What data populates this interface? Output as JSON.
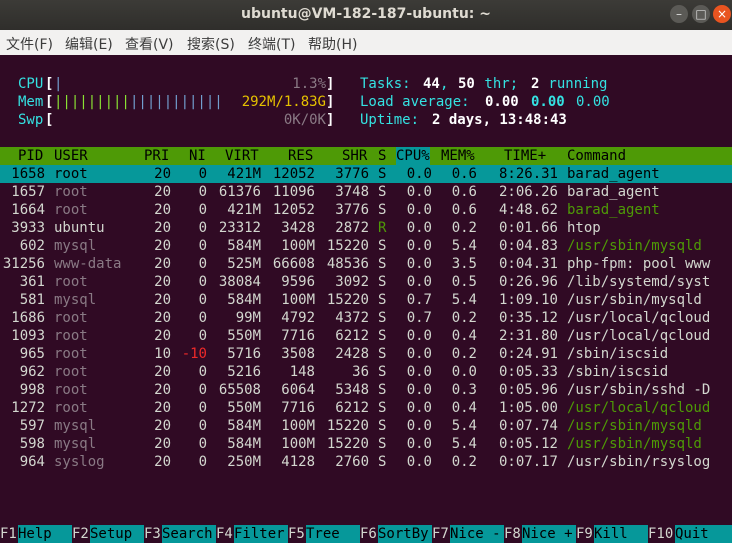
{
  "window": {
    "title": "ubuntu@VM-182-187-ubuntu: ~"
  },
  "menu": [
    "文件(F)",
    "编辑(E)",
    "查看(V)",
    "搜索(S)",
    "终端(T)",
    "帮助(H)"
  ],
  "meters": {
    "cpu": {
      "label": "CPU",
      "bar": "|",
      "value": "1.3%"
    },
    "mem": {
      "label": "Mem",
      "bar_blue": "|||||||||",
      "bar_yellow": "|||||||||||",
      "value": "292M/1.83G"
    },
    "swp": {
      "label": "Swp",
      "bar": "",
      "value": "0K/0K"
    }
  },
  "summary": {
    "tasks_label": "Tasks: ",
    "tasks": "44",
    "sep": ", ",
    "thr": "50",
    "thr_label": " thr; ",
    "running": "2",
    "running_label": " running",
    "load_label": "Load average: ",
    "load1": "0.00",
    "load5": "0.00",
    "load15": "0.00",
    "uptime_label": "Uptime: ",
    "uptime": "2 days, 13:48:43"
  },
  "columns": [
    "PID",
    "USER",
    "PRI",
    "NI",
    "VIRT",
    "RES",
    "SHR",
    "S",
    "CPU%",
    "MEM%",
    "TIME+",
    "Command"
  ],
  "processes": [
    {
      "pid": "1658",
      "user": "root",
      "pri": "20",
      "ni": "0",
      "virt": "421M",
      "res": "12052",
      "shr": "3776",
      "s": "S",
      "cpu": "0.0",
      "mem": "0.6",
      "time": "8:26.31",
      "cmd": "barad_agent"
    },
    {
      "pid": "1657",
      "user": "root",
      "pri": "20",
      "ni": "0",
      "virt": "61376",
      "res": "11096",
      "shr": "3748",
      "s": "S",
      "cpu": "0.0",
      "mem": "0.6",
      "time": "2:06.26",
      "cmd": "barad_agent"
    },
    {
      "pid": "1664",
      "user": "root",
      "pri": "20",
      "ni": "0",
      "virt": "421M",
      "res": "12052",
      "shr": "3776",
      "s": "S",
      "cpu": "0.0",
      "mem": "0.6",
      "time": "4:48.62",
      "cmd": "barad_agent"
    },
    {
      "pid": "3933",
      "user": "ubuntu",
      "pri": "20",
      "ni": "0",
      "virt": "23312",
      "res": "3428",
      "shr": "2872",
      "s": "R",
      "cpu": "0.0",
      "mem": "0.2",
      "time": "0:01.66",
      "cmd": "htop"
    },
    {
      "pid": "602",
      "user": "mysql",
      "pri": "20",
      "ni": "0",
      "virt": "584M",
      "res": "100M",
      "shr": "15220",
      "s": "S",
      "cpu": "0.0",
      "mem": "5.4",
      "time": "0:04.83",
      "cmd": "/usr/sbin/mysqld"
    },
    {
      "pid": "31256",
      "user": "www-data",
      "pri": "20",
      "ni": "0",
      "virt": "525M",
      "res": "66608",
      "shr": "48536",
      "s": "S",
      "cpu": "0.0",
      "mem": "3.5",
      "time": "0:04.31",
      "cmd": "php-fpm: pool www"
    },
    {
      "pid": "361",
      "user": "root",
      "pri": "20",
      "ni": "0",
      "virt": "38084",
      "res": "9596",
      "shr": "3092",
      "s": "S",
      "cpu": "0.0",
      "mem": "0.5",
      "time": "0:26.96",
      "cmd": "/lib/systemd/syst"
    },
    {
      "pid": "581",
      "user": "mysql",
      "pri": "20",
      "ni": "0",
      "virt": "584M",
      "res": "100M",
      "shr": "15220",
      "s": "S",
      "cpu": "0.7",
      "mem": "5.4",
      "time": "1:09.10",
      "cmd": "/usr/sbin/mysqld"
    },
    {
      "pid": "1686",
      "user": "root",
      "pri": "20",
      "ni": "0",
      "virt": "99M",
      "res": "4792",
      "shr": "4372",
      "s": "S",
      "cpu": "0.7",
      "mem": "0.2",
      "time": "0:35.12",
      "cmd": "/usr/local/qcloud"
    },
    {
      "pid": "1093",
      "user": "root",
      "pri": "20",
      "ni": "0",
      "virt": "550M",
      "res": "7716",
      "shr": "6212",
      "s": "S",
      "cpu": "0.0",
      "mem": "0.4",
      "time": "2:31.80",
      "cmd": "/usr/local/qcloud"
    },
    {
      "pid": "965",
      "user": "root",
      "pri": "10",
      "ni": "-10",
      "virt": "5716",
      "res": "3508",
      "shr": "2428",
      "s": "S",
      "cpu": "0.0",
      "mem": "0.2",
      "time": "0:24.91",
      "cmd": "/sbin/iscsid"
    },
    {
      "pid": "962",
      "user": "root",
      "pri": "20",
      "ni": "0",
      "virt": "5216",
      "res": "148",
      "shr": "36",
      "s": "S",
      "cpu": "0.0",
      "mem": "0.0",
      "time": "0:05.33",
      "cmd": "/sbin/iscsid"
    },
    {
      "pid": "998",
      "user": "root",
      "pri": "20",
      "ni": "0",
      "virt": "65508",
      "res": "6064",
      "shr": "5348",
      "s": "S",
      "cpu": "0.0",
      "mem": "0.3",
      "time": "0:05.96",
      "cmd": "/usr/sbin/sshd -D"
    },
    {
      "pid": "1272",
      "user": "root",
      "pri": "20",
      "ni": "0",
      "virt": "550M",
      "res": "7716",
      "shr": "6212",
      "s": "S",
      "cpu": "0.0",
      "mem": "0.4",
      "time": "1:05.00",
      "cmd": "/usr/local/qcloud"
    },
    {
      "pid": "597",
      "user": "mysql",
      "pri": "20",
      "ni": "0",
      "virt": "584M",
      "res": "100M",
      "shr": "15220",
      "s": "S",
      "cpu": "0.0",
      "mem": "5.4",
      "time": "0:07.74",
      "cmd": "/usr/sbin/mysqld"
    },
    {
      "pid": "598",
      "user": "mysql",
      "pri": "20",
      "ni": "0",
      "virt": "584M",
      "res": "100M",
      "shr": "15220",
      "s": "S",
      "cpu": "0.0",
      "mem": "5.4",
      "time": "0:05.12",
      "cmd": "/usr/sbin/mysqld"
    },
    {
      "pid": "964",
      "user": "syslog",
      "pri": "20",
      "ni": "0",
      "virt": "250M",
      "res": "4128",
      "shr": "2760",
      "s": "S",
      "cpu": "0.0",
      "mem": "0.2",
      "time": "0:07.17",
      "cmd": "/usr/sbin/rsyslog"
    }
  ],
  "fkeys": [
    {
      "key": "F1",
      "label": "Help"
    },
    {
      "key": "F2",
      "label": "Setup"
    },
    {
      "key": "F3",
      "label": "Search"
    },
    {
      "key": "F4",
      "label": "Filter"
    },
    {
      "key": "F5",
      "label": "Tree"
    },
    {
      "key": "F6",
      "label": "SortBy"
    },
    {
      "key": "F7",
      "label": "Nice -"
    },
    {
      "key": "F8",
      "label": "Nice +"
    },
    {
      "key": "F9",
      "label": "Kill"
    },
    {
      "key": "F10",
      "label": "Quit"
    }
  ],
  "colors": {
    "terminal_bg": "#300a24",
    "header_bg": "#4e9a06",
    "selection_bg": "#06989a",
    "close_button": "#e95420"
  }
}
